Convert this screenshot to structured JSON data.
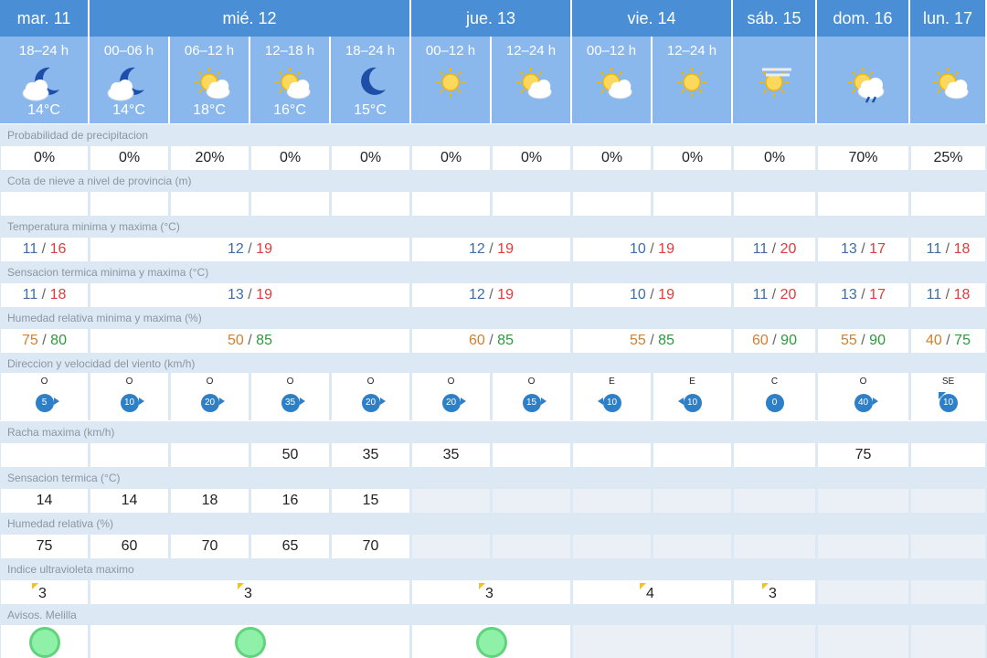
{
  "days": [
    "mar. 11",
    "mié. 12",
    "jue. 13",
    "vie. 14",
    "sáb. 15",
    "dom. 16",
    "lun. 17"
  ],
  "slots": [
    {
      "period": "18–24 h",
      "icon": "moon-cloud-icon",
      "temp": "14°C"
    },
    {
      "period": "00–06 h",
      "icon": "moon-cloud-icon",
      "temp": "14°C"
    },
    {
      "period": "06–12 h",
      "icon": "sun-cloud-icon",
      "temp": "18°C"
    },
    {
      "period": "12–18 h",
      "icon": "sun-cloud-icon",
      "temp": "16°C"
    },
    {
      "period": "18–24 h",
      "icon": "moon-icon",
      "temp": "15°C"
    },
    {
      "period": "00–12 h",
      "icon": "sun-icon",
      "temp": ""
    },
    {
      "period": "12–24 h",
      "icon": "sun-cloud-icon",
      "temp": ""
    },
    {
      "period": "00–12 h",
      "icon": "sun-cloud-icon",
      "temp": ""
    },
    {
      "period": "12–24 h",
      "icon": "sun-icon",
      "temp": ""
    },
    {
      "period": "",
      "icon": "sun-haze-icon",
      "temp": ""
    },
    {
      "period": "",
      "icon": "sun-rain-icon",
      "temp": ""
    },
    {
      "period": "",
      "icon": "sun-cloud-icon",
      "temp": ""
    }
  ],
  "labels": {
    "precip": "Probabilidad de precipitacion",
    "snow": "Cota de nieve a nivel de provincia (m)",
    "temp": "Temperatura minima y maxima (°C)",
    "feels": "Sensacion termica minima y maxima (°C)",
    "hum": "Humedad relativa minima y maxima (%)",
    "wind": "Direccion y velocidad del viento (km/h)",
    "gust": "Racha maxima (km/h)",
    "feelsh": "Sensacion termica (°C)",
    "humh": "Humedad relativa (%)",
    "uv": "Indice ultravioleta maximo",
    "avisos": "Avisos. Melilla"
  },
  "precip": [
    "0%",
    "0%",
    "20%",
    "0%",
    "0%",
    "0%",
    "0%",
    "0%",
    "0%",
    "0%",
    "70%",
    "25%"
  ],
  "temp_minmax": [
    {
      "min": "11",
      "max": "16"
    },
    {
      "min": "12",
      "max": "19"
    },
    {
      "min": "12",
      "max": "19"
    },
    {
      "min": "10",
      "max": "19"
    },
    {
      "min": "11",
      "max": "20"
    },
    {
      "min": "13",
      "max": "17"
    },
    {
      "min": "11",
      "max": "18"
    }
  ],
  "feels_minmax": [
    {
      "min": "11",
      "max": "18"
    },
    {
      "min": "13",
      "max": "19"
    },
    {
      "min": "12",
      "max": "19"
    },
    {
      "min": "10",
      "max": "19"
    },
    {
      "min": "11",
      "max": "20"
    },
    {
      "min": "13",
      "max": "17"
    },
    {
      "min": "11",
      "max": "18"
    }
  ],
  "hum_minmax": [
    {
      "min": "75",
      "max": "80"
    },
    {
      "min": "50",
      "max": "85"
    },
    {
      "min": "60",
      "max": "85"
    },
    {
      "min": "55",
      "max": "85"
    },
    {
      "min": "60",
      "max": "90"
    },
    {
      "min": "55",
      "max": "90"
    },
    {
      "min": "40",
      "max": "75"
    }
  ],
  "wind": [
    {
      "dir": "O",
      "speed": "5"
    },
    {
      "dir": "O",
      "speed": "10"
    },
    {
      "dir": "O",
      "speed": "20"
    },
    {
      "dir": "O",
      "speed": "35"
    },
    {
      "dir": "O",
      "speed": "20"
    },
    {
      "dir": "O",
      "speed": "20"
    },
    {
      "dir": "O",
      "speed": "15"
    },
    {
      "dir": "E",
      "speed": "10"
    },
    {
      "dir": "E",
      "speed": "10"
    },
    {
      "dir": "C",
      "speed": "0"
    },
    {
      "dir": "O",
      "speed": "40"
    },
    {
      "dir": "SE",
      "speed": "10"
    }
  ],
  "gust": [
    "",
    "",
    "",
    "50",
    "35",
    "35",
    "",
    "",
    "",
    "",
    "75",
    ""
  ],
  "feels_hourly": [
    "14",
    "14",
    "18",
    "16",
    "15"
  ],
  "hum_hourly": [
    "75",
    "60",
    "70",
    "65",
    "70"
  ],
  "uv": [
    "3",
    "3",
    "3",
    "4",
    "3",
    "",
    ""
  ],
  "sep": "/",
  "colors": {
    "header": "#4a8fd6",
    "subheader": "#8ab8ec",
    "label_bg": "#dce9f4",
    "min": "#3d6fa6",
    "max": "#e23b3b",
    "hum_min": "#d08030",
    "hum_max": "#2a9a3a",
    "wind_badge": "#2d7fc7",
    "warning_green": "#8ff0a8"
  }
}
